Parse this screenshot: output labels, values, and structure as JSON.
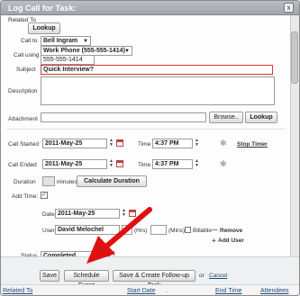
{
  "dialog": {
    "title": "Log Call for Task:",
    "close_glyph": "x"
  },
  "form": {
    "related_to": {
      "label": "Related To",
      "button": "Lookup"
    },
    "call_to": {
      "label": "Call to",
      "value": "Bell Ingram"
    },
    "call_using": {
      "label": "Call using",
      "select": "Work Phone (555-555-1414)",
      "value": "555-555-1414"
    },
    "subject": {
      "label": "Subject",
      "value": "Quick Interview?"
    },
    "description": {
      "label": "Description",
      "value": ""
    },
    "attachment": {
      "label": "Attachment",
      "browse": "Browse..",
      "lookup": "Lookup"
    },
    "call_started": {
      "label": "Call Started",
      "date": "2011-May-25",
      "time_label": "Time",
      "time": "4:37 PM",
      "stop_timer": "Stop Timer"
    },
    "call_ended": {
      "label": "Call Ended",
      "date": "2011-May-25",
      "time_label": "Time",
      "time": "4:37 PM"
    },
    "duration": {
      "label": "Duration",
      "unit": "minutes",
      "button": "Calculate Duration"
    },
    "add_time": {
      "label": "Add Time:",
      "date_label": "Date",
      "date": "2011-May-25",
      "user_label": "User",
      "user": "David Melochel",
      "hrs": "(Hrs)",
      "mins": "(Mins)",
      "billable": "Billable",
      "remove": "Remove",
      "add_user": "Add User"
    },
    "status": {
      "label": "Status",
      "value": "Completed"
    }
  },
  "actions": {
    "save": "Save",
    "schedule": "Schedule Event",
    "save_followup": "Save & Create Follow-up Task",
    "or": "or",
    "cancel": "Cancel"
  },
  "background_table": {
    "columns": [
      "Related To",
      "Start Date",
      "End Time",
      "Attendees"
    ],
    "sort_marker": "."
  },
  "colors": {
    "accent_arrow": "#e01010",
    "subject_border": "#d23b3b"
  }
}
